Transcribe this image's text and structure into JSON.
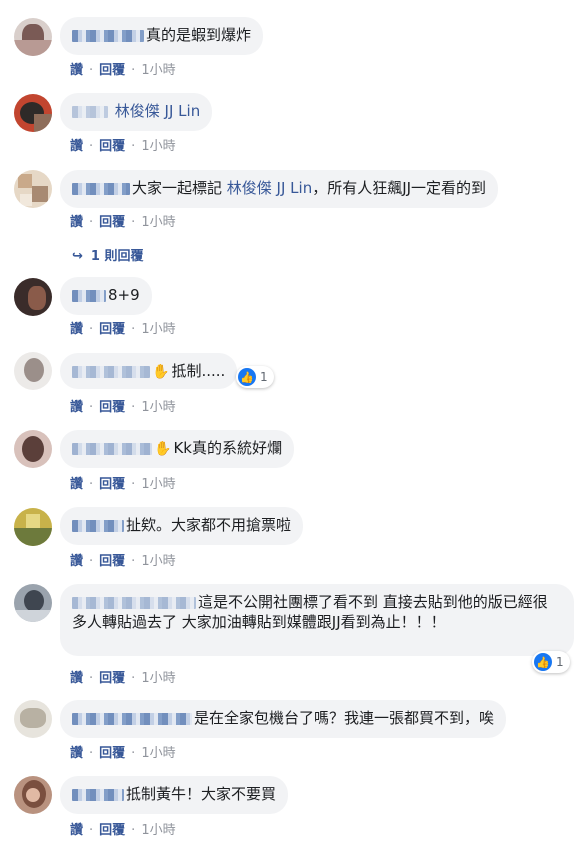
{
  "action_labels": {
    "like": "讚",
    "reply": "回覆",
    "separator": "·"
  },
  "colors": {
    "link": "#385898",
    "bubble": "#f2f3f5",
    "meta": "#90949c",
    "like_blue": "#1877f2"
  },
  "comments": [
    {
      "text": "真的是蝦到爆炸",
      "time": "1小時"
    },
    {
      "tag": "林俊傑 JJ Lin",
      "time": "1小時"
    },
    {
      "text_before": "大家一起標記 ",
      "tag": "林俊傑 JJ Lin",
      "text_after": "，所有人狂飆JJ一定看的到",
      "time": "1小時",
      "replies_label": "1 則回覆"
    },
    {
      "text": "8+9",
      "time": "1小時"
    },
    {
      "text": "抵制.....",
      "time": "1小時",
      "reaction_count": "1"
    },
    {
      "text": "Kk真的系統好爛",
      "time": "1小時"
    },
    {
      "text": "扯欸。大家都不用搶票啦",
      "time": "1小時"
    },
    {
      "text": "這是不公開社團標了看不到 直接去貼到他的版已經很多人轉貼過去了 大家加油轉貼到媒體跟JJ看到為止！！！",
      "time": "1小時",
      "reaction_count": "1"
    },
    {
      "text": "是在全家包機台了嗎？我連一張都買不到，唉",
      "time": "1小時"
    },
    {
      "text": "抵制黃牛！大家不要買",
      "time": "1小時"
    }
  ]
}
